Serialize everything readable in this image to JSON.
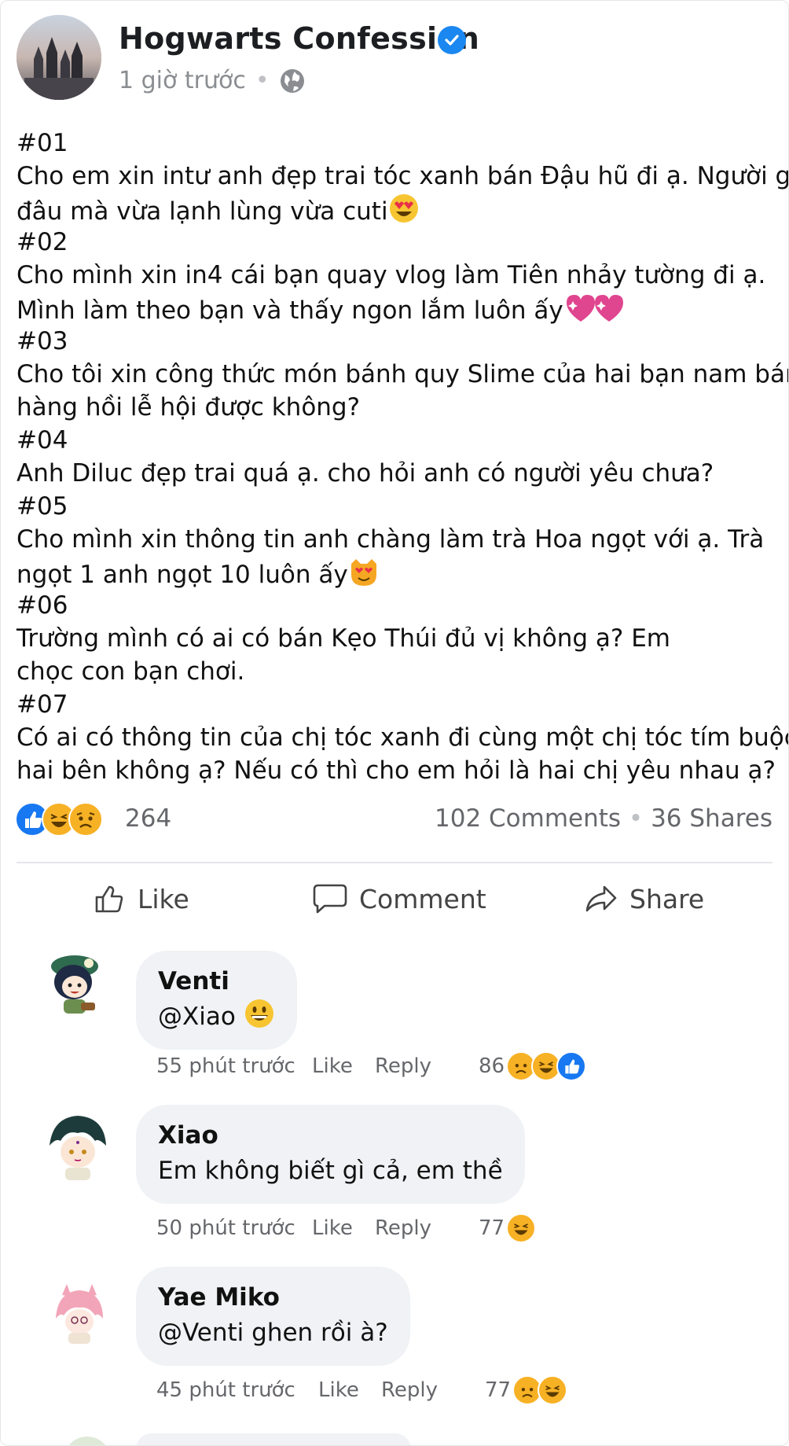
{
  "post": {
    "page_name": "Hogwarts Confession",
    "time": "1 giờ trước",
    "separator": "•",
    "lines": [
      {
        "text": "#01"
      },
      {
        "text": "Cho em xin intư anh đẹp trai tóc xanh bán Đậu hũ đi ạ. Người gì"
      },
      {
        "text": "đâu mà vừa lạnh lùng vừa cuti",
        "emoji": "heart-eyes"
      },
      {
        "text": "#02"
      },
      {
        "text": "Cho mình xin in4 cái bạn quay vlog làm Tiên nhảy tường đi ạ."
      },
      {
        "text": "Mình làm theo bạn và thấy ngon lắm luôn ấy",
        "emoji": "sparkling-hearts"
      },
      {
        "text": "#03"
      },
      {
        "text": "Cho tôi xin công thức món bánh quy Slime của hai bạn nam bán"
      },
      {
        "text": "hàng hồi lễ hội được không?"
      },
      {
        "text": "#04"
      },
      {
        "text": "Anh Diluc đẹp trai quá ạ. cho hỏi anh có người yêu chưa?"
      },
      {
        "text": "#05"
      },
      {
        "text": "Cho mình xin thông tin anh chàng làm trà Hoa ngọt với ạ. Trà"
      },
      {
        "text": "ngọt 1 anh ngọt 10 luôn ấy",
        "emoji": "heart-eyes-cat"
      },
      {
        "text": "#06"
      },
      {
        "text": "Trường mình có ai có bán Kẹo Thúi đủ vị không ạ? Em"
      },
      {
        "text": "chọc con bạn chơi."
      },
      {
        "text": "#07"
      },
      {
        "text": "Có ai có thông tin của chị tóc xanh đi cùng một chị tóc tím buộc"
      },
      {
        "text": "hai bên không ạ? Nếu có thì cho em hỏi là hai chị yêu nhau ạ?"
      }
    ],
    "reaction_count": "264",
    "comments_label": "102 Comments",
    "shares_label": "36 Shares"
  },
  "actions": {
    "like": "Like",
    "comment": "Comment",
    "share": "Share"
  },
  "comments": [
    {
      "name": "Venti",
      "text": "@Xiao",
      "text_emoji": "grinning",
      "time": "55 phút trước",
      "like": "Like",
      "reply": "Reply",
      "count": "86",
      "reactions": [
        "sad",
        "haha",
        "like"
      ]
    },
    {
      "name": "Xiao",
      "text": "Em không biết gì cả, em thề",
      "time": "50 phút trước",
      "like": "Like",
      "reply": "Reply",
      "count": "77",
      "reactions": [
        "haha"
      ]
    },
    {
      "name": "Yae Miko",
      "text": "@Venti ghen rồi à?",
      "time": "45 phút trước",
      "like": "Like",
      "reply": "Reply",
      "count": "77",
      "reactions": [
        "sad",
        "haha"
      ]
    }
  ],
  "colors": {
    "facebook_blue": "#1778f2",
    "verified_blue": "#1b87f0",
    "reaction_yellow": "#f7b125",
    "bubble_gray": "#f0f2f5",
    "muted_text": "#65676b"
  },
  "icons": [
    "verified-badge-icon",
    "globe-icon",
    "like-reaction-icon",
    "haha-reaction-icon",
    "sad-reaction-icon",
    "thumbs-up-icon",
    "comment-bubble-icon",
    "share-arrow-icon"
  ]
}
